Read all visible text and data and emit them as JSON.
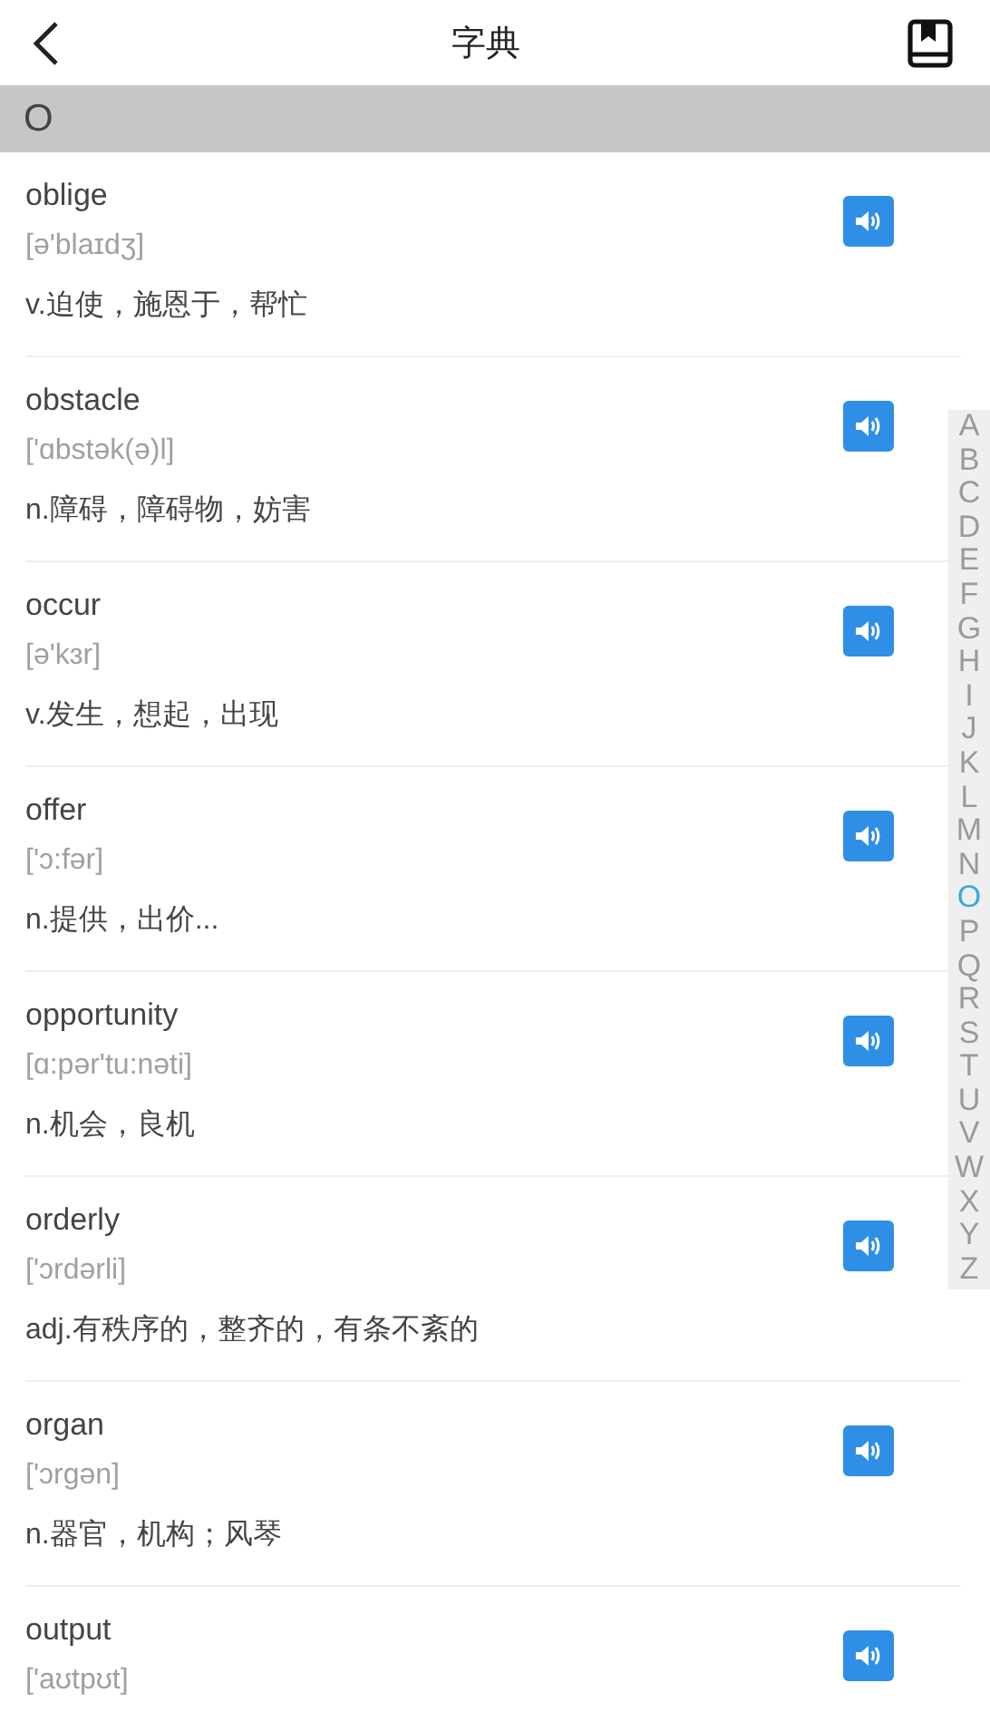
{
  "header": {
    "title": "字典"
  },
  "section": {
    "letter": "O"
  },
  "entries": [
    {
      "word": "oblige",
      "phonetic": "[ə'blaɪdʒ]",
      "definition": "v.迫使，施恩于，帮忙"
    },
    {
      "word": "obstacle",
      "phonetic": "['ɑbstək(ə)l]",
      "definition": "n.障碍，障碍物，妨害"
    },
    {
      "word": "occur",
      "phonetic": "[ə'kɜr]",
      "definition": "v.发生，想起，出现"
    },
    {
      "word": "offer",
      "phonetic": "['ɔ:fər]",
      "definition": "n.提供，出价..."
    },
    {
      "word": "opportunity",
      "phonetic": "[ɑ:pər'tu:nəti]",
      "definition": "n.机会，良机"
    },
    {
      "word": "orderly",
      "phonetic": "['ɔrdərli]",
      "definition": "adj.有秩序的，整齐的，有条不紊的"
    },
    {
      "word": "organ",
      "phonetic": "['ɔrgən]",
      "definition": "n.器官，机构；风琴"
    },
    {
      "word": "output",
      "phonetic": "['aʊtpʊt]"
    }
  ],
  "index": [
    {
      "letter": "A",
      "selected": false
    },
    {
      "letter": "B",
      "selected": false
    },
    {
      "letter": "C",
      "selected": false
    },
    {
      "letter": "D",
      "selected": false
    },
    {
      "letter": "E",
      "selected": false
    },
    {
      "letter": "F",
      "selected": false
    },
    {
      "letter": "G",
      "selected": false
    },
    {
      "letter": "H",
      "selected": false
    },
    {
      "letter": "I",
      "selected": false
    },
    {
      "letter": "J",
      "selected": false
    },
    {
      "letter": "K",
      "selected": false
    },
    {
      "letter": "L",
      "selected": false
    },
    {
      "letter": "M",
      "selected": false
    },
    {
      "letter": "N",
      "selected": false
    },
    {
      "letter": "O",
      "selected": true
    },
    {
      "letter": "P",
      "selected": false
    },
    {
      "letter": "Q",
      "selected": false
    },
    {
      "letter": "R",
      "selected": false
    },
    {
      "letter": "S",
      "selected": false
    },
    {
      "letter": "T",
      "selected": false
    },
    {
      "letter": "U",
      "selected": false
    },
    {
      "letter": "V",
      "selected": false
    },
    {
      "letter": "W",
      "selected": false
    },
    {
      "letter": "X",
      "selected": false
    },
    {
      "letter": "Y",
      "selected": false
    },
    {
      "letter": "Z",
      "selected": false
    }
  ]
}
